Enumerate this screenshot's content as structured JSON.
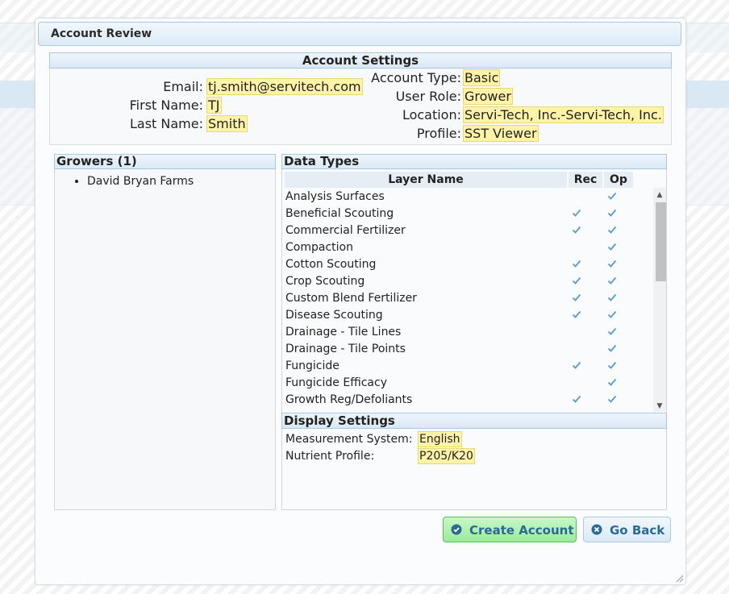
{
  "dialog": {
    "title": "Account Review"
  },
  "account_settings": {
    "header": "Account Settings",
    "left": [
      {
        "label": "Email:",
        "value": "tj.smith@servitech.com"
      },
      {
        "label": "First Name:",
        "value": "TJ"
      },
      {
        "label": "Last Name:",
        "value": "Smith"
      }
    ],
    "right": [
      {
        "label": "Account Type:",
        "value": "Basic"
      },
      {
        "label": "User Role:",
        "value": "Grower"
      },
      {
        "label": "Location:",
        "value": "Servi-Tech, Inc.-Servi-Tech, Inc."
      },
      {
        "label": "Profile:",
        "value": "SST Viewer"
      }
    ]
  },
  "growers": {
    "header": "Growers (1)",
    "items": [
      "David Bryan Farms"
    ]
  },
  "data_types": {
    "header": "Data Types",
    "columns": {
      "name": "Layer Name",
      "rec": "Rec",
      "op": "Op"
    },
    "rows": [
      {
        "name": "Analysis Surfaces",
        "rec": false,
        "op": true
      },
      {
        "name": "Beneficial Scouting",
        "rec": true,
        "op": true
      },
      {
        "name": "Commercial Fertilizer",
        "rec": true,
        "op": true
      },
      {
        "name": "Compaction",
        "rec": false,
        "op": true
      },
      {
        "name": "Cotton Scouting",
        "rec": true,
        "op": true
      },
      {
        "name": "Crop Scouting",
        "rec": true,
        "op": true
      },
      {
        "name": "Custom Blend Fertilizer",
        "rec": true,
        "op": true
      },
      {
        "name": "Disease Scouting",
        "rec": true,
        "op": true
      },
      {
        "name": "Drainage - Tile Lines",
        "rec": false,
        "op": true
      },
      {
        "name": "Drainage - Tile Points",
        "rec": false,
        "op": true
      },
      {
        "name": "Fungicide",
        "rec": true,
        "op": true
      },
      {
        "name": "Fungicide Efficacy",
        "rec": false,
        "op": true
      },
      {
        "name": "Growth Reg/Defoliants",
        "rec": true,
        "op": true
      }
    ]
  },
  "display_settings": {
    "header": "Display Settings",
    "rows": [
      {
        "label": "Measurement System:",
        "value": "English"
      },
      {
        "label": "Nutrient Profile:",
        "value": "P205/K20"
      }
    ]
  },
  "buttons": {
    "create": "Create Account",
    "back": "Go Back"
  },
  "colors": {
    "check": "#5b9bc8",
    "highlight": "#fff3a8",
    "button_text": "#2a6a95"
  }
}
